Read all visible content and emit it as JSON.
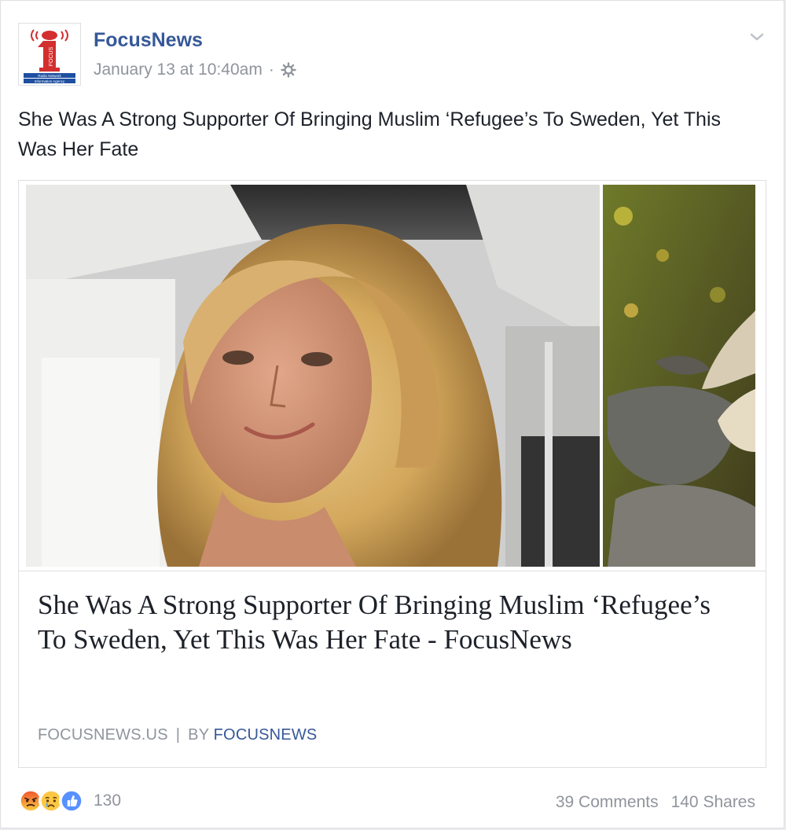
{
  "post": {
    "page_name": "FocusNews",
    "timestamp": "January 13 at 10:40am",
    "separator": "·",
    "text": "She Was A Strong Supporter Of Bringing Muslim ‘Refugee’s To Sweden, Yet This Was Her Fate",
    "logo_text": {
      "main": "FOCUS",
      "line1": "Radio Network",
      "line2": "Information Agency"
    }
  },
  "link_card": {
    "title": "She Was A Strong Supporter Of Bringing Muslim ‘Refugee’s To Sweden, Yet This Was Her Fate - FocusNews",
    "domain": "FOCUSNEWS.US",
    "separator": "|",
    "by_label": "BY",
    "author": "FOCUSNEWS"
  },
  "footer": {
    "reaction_count": "130",
    "reactions": [
      "angry-icon",
      "sad-icon",
      "like-icon"
    ],
    "comments": "39 Comments",
    "shares": "140 Shares"
  },
  "colors": {
    "link_blue": "#365899",
    "meta_gray": "#90949c",
    "like_blue": "#5890ff",
    "angry_orange": "#f0582b",
    "sad_yellow": "#fcc843"
  }
}
